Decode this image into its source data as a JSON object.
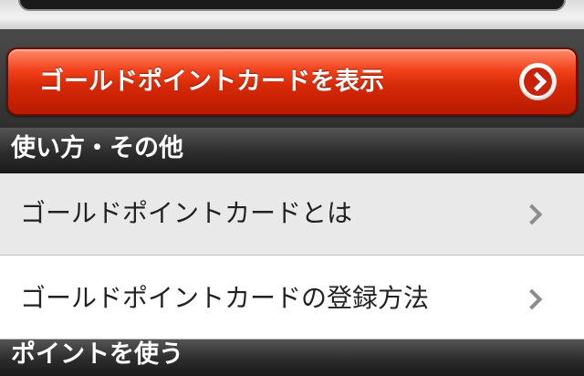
{
  "header": {
    "show_card_button_label": "ゴールドポイントカードを表示"
  },
  "sections": [
    {
      "title": "使い方・その他",
      "items": [
        {
          "label": "ゴールドポイントカードとは"
        },
        {
          "label": "ゴールドポイントカードの登録方法"
        }
      ]
    },
    {
      "title": "ポイントを使う"
    }
  ],
  "colors": {
    "button_red": "#d72a08",
    "section_header": "#2c2c2c",
    "row_alt": "#e9e9e9"
  }
}
